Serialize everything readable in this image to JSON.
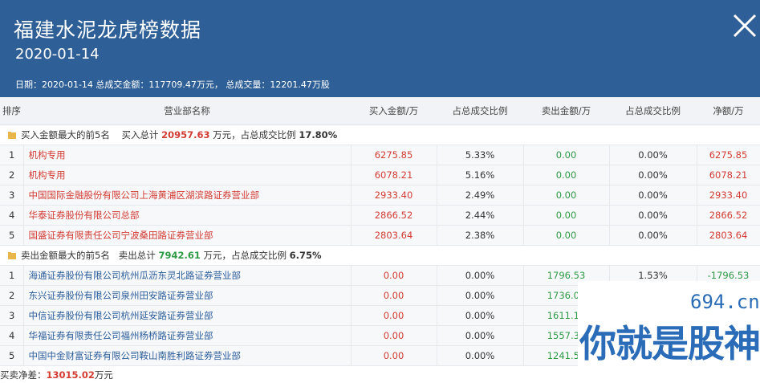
{
  "header": {
    "title": "福建水泥龙虎榜数据",
    "date": "2020-01-14",
    "summary": "日期：2020-01-14 总成交金额：117709.47万元， 总成交量：12201.47万股"
  },
  "columns": [
    "排序",
    "营业部名称",
    "买入金额/万",
    "占总成交比例",
    "卖出金额/万",
    "占总成交比例",
    "净额/万"
  ],
  "buy_section": {
    "label": "买入金额最大的前5名",
    "total_prefix": "买入总计",
    "total_value": "20957.63",
    "total_unit": "万元，占总成交比例",
    "total_ratio": "17.80%"
  },
  "buy_rows": [
    {
      "rank": "1",
      "name": "机构专用",
      "buy": "6275.85",
      "buy_ratio": "5.33%",
      "sell": "0.00",
      "sell_ratio": "0.00%",
      "net": "6275.85"
    },
    {
      "rank": "2",
      "name": "机构专用",
      "buy": "6078.21",
      "buy_ratio": "5.16%",
      "sell": "0.00",
      "sell_ratio": "0.00%",
      "net": "6078.21"
    },
    {
      "rank": "3",
      "name": "中国国际金融股份有限公司上海黄浦区湖滨路证券营业部",
      "buy": "2933.40",
      "buy_ratio": "2.49%",
      "sell": "0.00",
      "sell_ratio": "0.00%",
      "net": "2933.40"
    },
    {
      "rank": "4",
      "name": "华泰证券股份有限公司总部",
      "buy": "2866.52",
      "buy_ratio": "2.44%",
      "sell": "0.00",
      "sell_ratio": "0.00%",
      "net": "2866.52"
    },
    {
      "rank": "5",
      "name": "国盛证券有限责任公司宁波桑田路证券营业部",
      "buy": "2803.64",
      "buy_ratio": "2.38%",
      "sell": "0.00",
      "sell_ratio": "0.00%",
      "net": "2803.64"
    }
  ],
  "sell_section": {
    "label": "卖出金额最大的前5名",
    "total_prefix": "卖出总计",
    "total_value": "7942.61",
    "total_unit": "万元，占总成交比例",
    "total_ratio": "6.75%"
  },
  "sell_rows": [
    {
      "rank": "1",
      "name": "海通证券股份有限公司杭州瓜沥东灵北路证券营业部",
      "buy": "0.00",
      "buy_ratio": "0.00%",
      "sell": "1796.53",
      "sell_ratio": "1.53%",
      "net": "-1796.53"
    },
    {
      "rank": "2",
      "name": "东兴证券股份有限公司泉州田安路证券营业部",
      "buy": "0.00",
      "buy_ratio": "0.00%",
      "sell": "1736.07",
      "sell_ratio": "",
      "net": ""
    },
    {
      "rank": "3",
      "name": "中信证券股份有限公司杭州延安路证券营业部",
      "buy": "0.00",
      "buy_ratio": "0.00%",
      "sell": "1611.16",
      "sell_ratio": "",
      "net": ""
    },
    {
      "rank": "4",
      "name": "华福证券有限责任公司福州杨桥路证券营业部",
      "buy": "0.00",
      "buy_ratio": "0.00%",
      "sell": "1557.36",
      "sell_ratio": "",
      "net": ""
    },
    {
      "rank": "5",
      "name": "中国中金财富证券有限公司鞍山南胜利路证券营业部",
      "buy": "0.00",
      "buy_ratio": "0.00%",
      "sell": "1241.50",
      "sell_ratio": "",
      "net": ""
    }
  ],
  "footer": {
    "prefix": "买卖净差：",
    "value": "13015.02",
    "unit": "万元"
  },
  "watermark": {
    "domain": "694.cn",
    "slogan": "你就是股神"
  },
  "colors": {
    "header_bg": "#2e5f96",
    "buy": "#d23c33",
    "sell": "#2e9a45",
    "broker_link": "#2b5d9b"
  }
}
